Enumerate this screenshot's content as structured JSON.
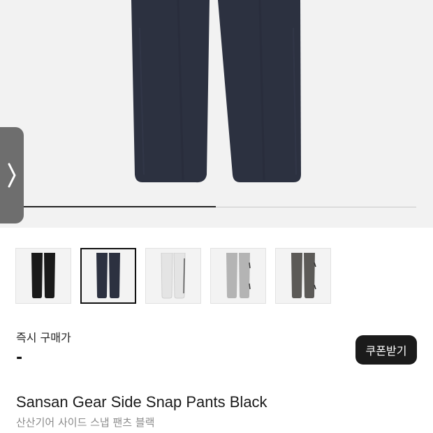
{
  "gallery": {
    "next_icon": "chevron-right-icon",
    "progress": 0.49,
    "thumbnails": [
      {
        "color_name": "black",
        "color": "#1a1a1a",
        "selected": false
      },
      {
        "color_name": "navy",
        "color": "#2c3140",
        "selected": true
      },
      {
        "color_name": "white",
        "color": "#e4e4e4",
        "selected": false
      },
      {
        "color_name": "light-gray",
        "color": "#b4b4b4",
        "selected": false
      },
      {
        "color_name": "charcoal",
        "color": "#5c5a57",
        "selected": false
      }
    ]
  },
  "price": {
    "label": "즉시 구매가",
    "value": "-"
  },
  "coupon": {
    "label": "쿠폰받기"
  },
  "product": {
    "title": "Sansan Gear Side Snap Pants Black",
    "subtitle": "산산기어 사이드 스냅 팬츠 블랙"
  },
  "colors": {
    "hero_background": "#f2f2f2",
    "hero_pants": "#2c3140",
    "arrow_tab": "#6e6e6e",
    "coupon_background": "#1b1b1b"
  }
}
